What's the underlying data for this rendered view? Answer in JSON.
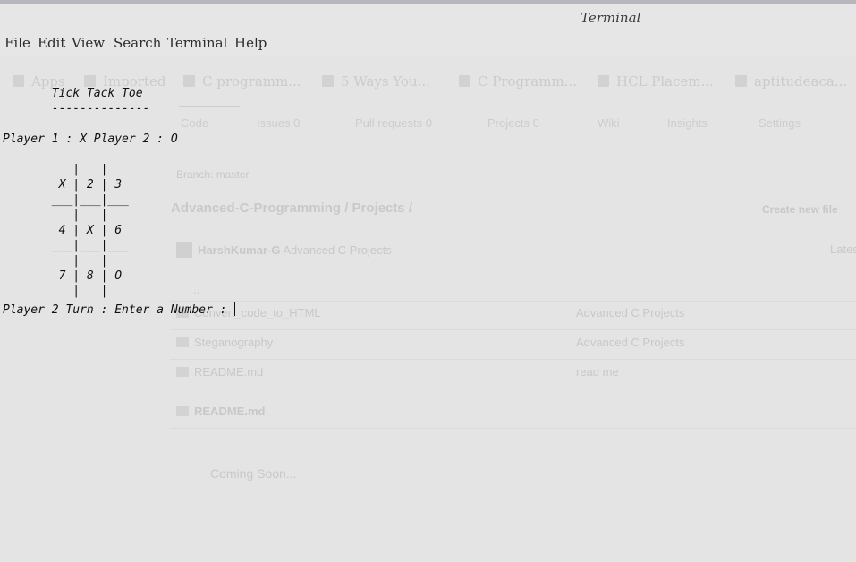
{
  "window": {
    "title": "Terminal"
  },
  "menu": [
    "File",
    "Edit",
    "View",
    "Search",
    "Terminal",
    "Help"
  ],
  "terminal": {
    "lines": [
      "       Tick Tack Toe",
      "       --------------",
      "Player 1 : X Player 2 : O",
      "          |   |",
      "        X | 2 | 3",
      "       ___|___|___",
      "          |   |",
      "        4 | X | 6",
      "       ___|___|___",
      "          |   |",
      "        7 | 8 | O",
      "          |   |",
      "Player 2 Turn : Enter a Number : "
    ]
  },
  "background_browser": {
    "bookmarks": [
      "Apps",
      "Imported",
      "C programm...",
      "5 Ways You...",
      "C Programm...",
      "HCL Placem...",
      "aptitudeaca..."
    ],
    "tabs": [
      "Code",
      "Issues 0",
      "Pull requests 0",
      "Projects 0",
      "Wiki",
      "Insights",
      "Settings"
    ],
    "branch": "Branch: master",
    "path": [
      "Advanced-C-Programming",
      "/",
      "Projects",
      "/"
    ],
    "create_new_file": "Create new file",
    "commit_author": "HarshKumar-G",
    "commit_message": "Advanced C Projects",
    "latest": "Latest",
    "parent_dir": "..",
    "files": [
      {
        "name": "Convert_code_to_HTML",
        "message": "Advanced C Projects"
      },
      {
        "name": "Steganography",
        "message": "Advanced C Projects"
      },
      {
        "name": "README.md",
        "message": "read me"
      }
    ],
    "readme_title": "README.md",
    "readme_body": "Coming Soon..."
  }
}
